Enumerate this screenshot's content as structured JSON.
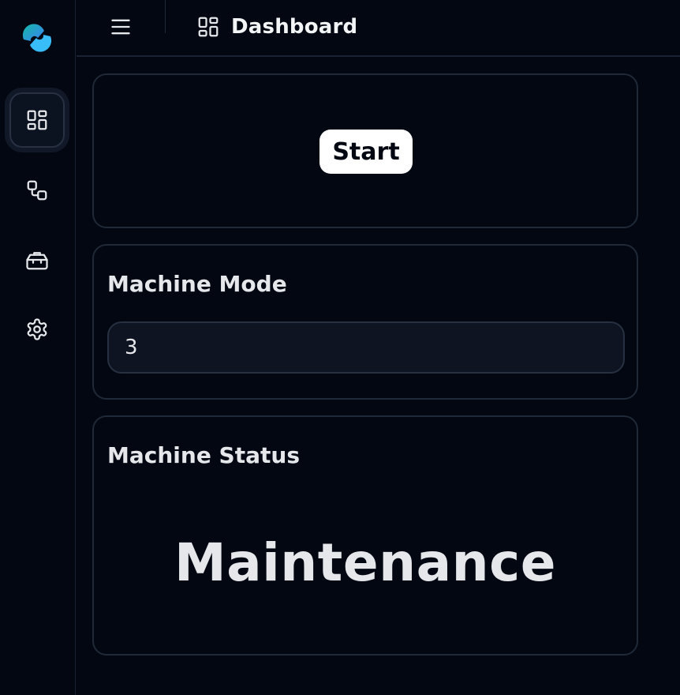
{
  "header": {
    "title": "Dashboard",
    "title_icon": "dashboard-icon",
    "menu_icon": "hamburger-menu-icon"
  },
  "sidebar": {
    "logo_icon": "app-logo-icon",
    "items": [
      {
        "id": "dashboard",
        "icon": "dashboard-icon",
        "active": true
      },
      {
        "id": "workflow",
        "icon": "workflow-icon",
        "active": false
      },
      {
        "id": "toolbox",
        "icon": "toolbox-icon",
        "active": false
      },
      {
        "id": "settings",
        "icon": "gear-icon",
        "active": false
      }
    ]
  },
  "start_card": {
    "button_label": "Start"
  },
  "mode_card": {
    "label": "Machine Mode",
    "value": "3"
  },
  "status_card": {
    "label": "Machine Status",
    "value": "Maintenance"
  },
  "colors": {
    "background": "#030712",
    "border": "#1f2937",
    "text": "#e5e7eb",
    "logo_teal": "#14b8a6",
    "logo_blue": "#3b82f6"
  }
}
